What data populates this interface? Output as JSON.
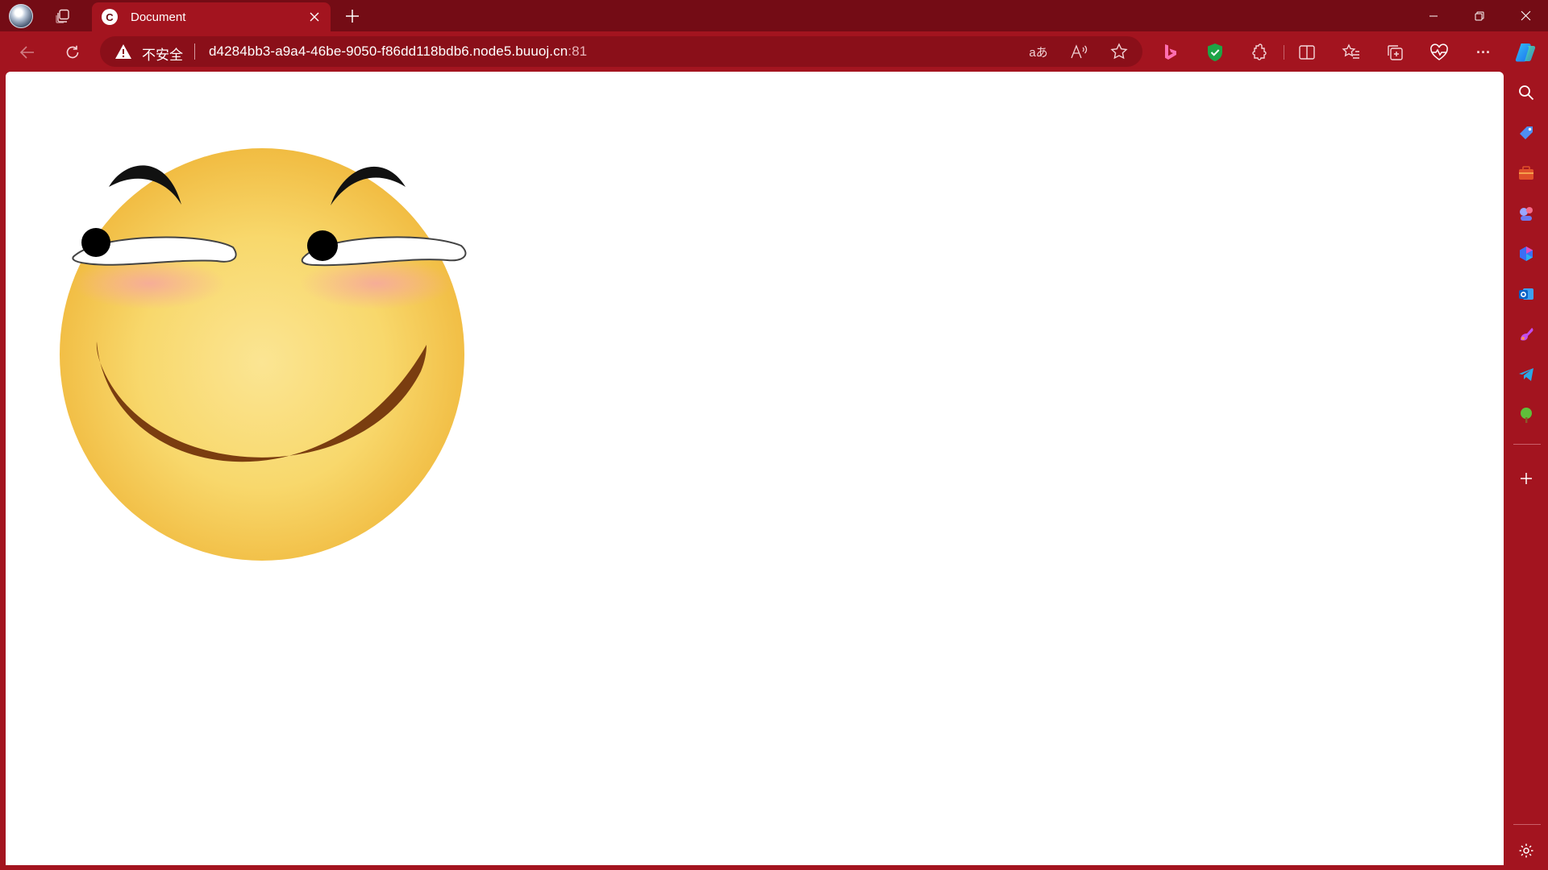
{
  "window": {
    "tab_title": "Document",
    "tab_favicon_letter": "C",
    "minimize_label": "Minimize",
    "restore_label": "Restore",
    "close_label": "Close"
  },
  "toolbar": {
    "security_status": "不安全",
    "url_host": "d4284bb3-a9a4-46be-9050-f86dd118bdb6.node5.buuoj.cn",
    "url_port": ":81",
    "translate_glyph": "aあ",
    "read_aloud_glyph": "A",
    "more_glyph": "···"
  },
  "page": {
    "content": "smiling-face-image",
    "face_colors": {
      "skin_light": "#fbe593",
      "skin_dark": "#f0b83c",
      "blush": "#f6a6a0",
      "mouth": "#7a3d10",
      "brow": "#111111"
    }
  },
  "sidebar": {
    "items": [
      "search",
      "shopping",
      "tools",
      "games",
      "microsoft-365",
      "outlook",
      "designer",
      "telegram",
      "tree",
      "add",
      "settings"
    ]
  },
  "colors": {
    "theme": "#a3141f",
    "titlebar": "#740c15",
    "addressbar": "#8a0f19"
  }
}
